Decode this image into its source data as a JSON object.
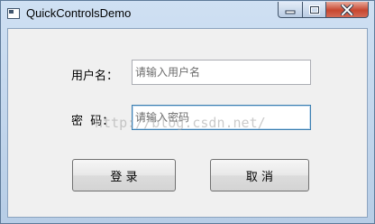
{
  "window": {
    "title": "QuickControlsDemo",
    "icons": {
      "app": "app-window-icon",
      "minimize": "minimize-icon",
      "maximize": "maximize-icon",
      "close": "close-icon"
    }
  },
  "form": {
    "username_label": "用户名：",
    "username_placeholder": "请输入用户名",
    "password_label": "密  码：",
    "password_placeholder": "请输入密码",
    "login_button": "登 录",
    "cancel_button": "取 消"
  },
  "watermark": "http://blog.csdn.net/",
  "colors": {
    "focus_border": "#3c7fb1",
    "close_button": "#c7462f"
  }
}
